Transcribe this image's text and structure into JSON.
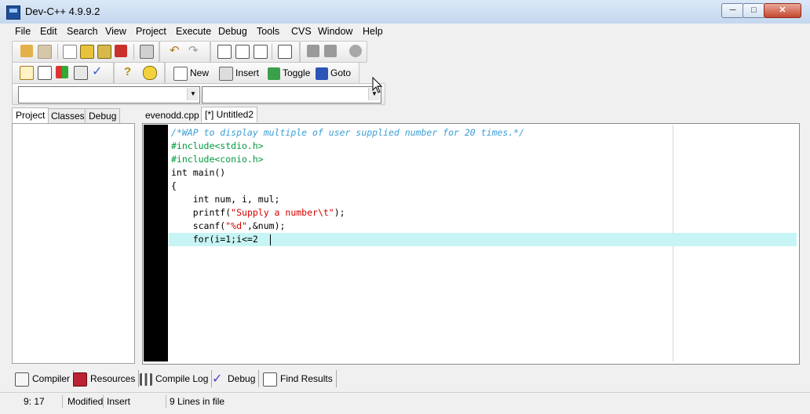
{
  "window": {
    "title": "Dev-C++ 4.9.9.2",
    "min_label": "─",
    "max_label": "□",
    "close_label": "✕"
  },
  "menu": [
    "File",
    "Edit",
    "Search",
    "View",
    "Project",
    "Execute",
    "Debug",
    "Tools",
    "CVS",
    "Window",
    "Help"
  ],
  "toolbar2": {
    "new_label": "New",
    "insert_label": "Insert",
    "toggle_label": "Toggle",
    "goto_label": "Goto"
  },
  "side_tabs": [
    "Project",
    "Classes",
    "Debug"
  ],
  "file_tabs": [
    "evenodd.cpp",
    "[*] Untitled2"
  ],
  "code_lines": [
    "/*WAP to display multiple of user supplied number for 20 times.*/",
    "#include<stdio.h>",
    "#include<conio.h>",
    "int main()",
    "{",
    "    int num, i, mul;",
    "    printf(\"Supply a number\\t\");",
    "    scanf(\"%d\",&num);",
    "    for(i=1;i<=2"
  ],
  "code_parts": {
    "printf_pre": "    printf(",
    "printf_str": "\"Supply a number\\t\"",
    "printf_post": ");",
    "scanf_pre": "    scanf(",
    "scanf_str": "\"%d\"",
    "scanf_post": ",&num);"
  },
  "bottom_tabs": [
    "Compiler",
    "Resources",
    "Compile Log",
    "Debug",
    "Find Results"
  ],
  "status": {
    "position": "9: 17",
    "modified": "Modified",
    "mode": "Insert",
    "lines": "9 Lines in file"
  },
  "colors": {
    "comment": "#3b9fd6",
    "preprocessor": "#009a3f",
    "string": "#d40000",
    "active_line": "#c7f4f4",
    "gutter": "#000000"
  }
}
